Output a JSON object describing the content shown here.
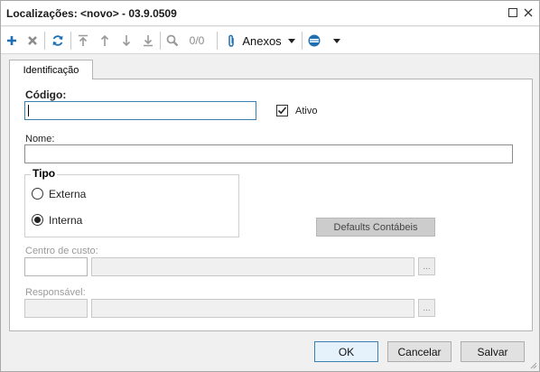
{
  "window": {
    "title": "Localizações: <novo> - 03.9.0509",
    "icons": {
      "maximize": "maximize-icon",
      "close": "close-icon"
    }
  },
  "toolbar": {
    "icons": [
      "add-icon",
      "delete-icon",
      "refresh-icon",
      "move-first-icon",
      "move-up-icon",
      "move-down-icon",
      "move-last-icon",
      "search-icon",
      "paperclip-icon",
      "dropdown-arrow-icon",
      "toggle-icon"
    ],
    "record_counter": "0/0",
    "attachments_label": "Anexos"
  },
  "tabs": [
    {
      "label": "Identificação",
      "active": true
    }
  ],
  "form": {
    "code_label": "Código:",
    "code_value": "",
    "active_label": "Ativo",
    "active_checked": true,
    "name_label": "Nome:",
    "name_value": "",
    "type_group_label": "Tipo",
    "type_options": [
      {
        "label": "Externa",
        "selected": false
      },
      {
        "label": "Interna",
        "selected": true
      }
    ],
    "defaults_button_label": "Defaults Contábeis",
    "cost_center_label": "Centro de custo:",
    "cost_center_code": "",
    "cost_center_desc": "",
    "responsible_label": "Responsável:",
    "responsible_code": "",
    "responsible_desc": "",
    "lookup_label": "..."
  },
  "footer": {
    "ok_label": "OK",
    "cancel_label": "Cancelar",
    "save_label": "Salvar"
  },
  "colors": {
    "accent_blue": "#1f6fb2",
    "focus_border": "#3c7fb1",
    "disabled_text": "#9a9a9a",
    "window_bg": "#f0f0f0"
  }
}
